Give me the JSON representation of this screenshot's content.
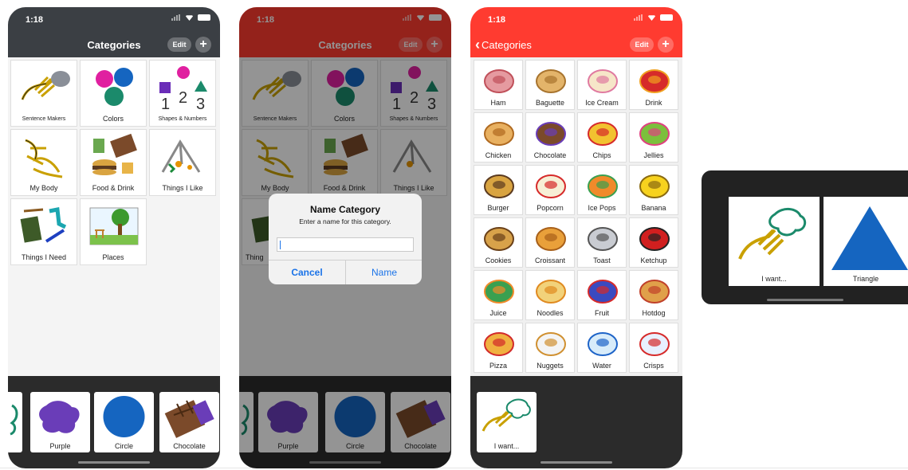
{
  "status": {
    "time": "1:18"
  },
  "screen1": {
    "title": "Categories",
    "edit_label": "Edit",
    "add_label": "+",
    "categories": [
      {
        "label": "Sentence Makers",
        "icon": "hand-speech-icon"
      },
      {
        "label": "Colors",
        "icon": "color-splats-icon"
      },
      {
        "label": "Shapes & Numbers",
        "icon": "shapes-numbers-icon"
      },
      {
        "label": "My Body",
        "icon": "body-icon"
      },
      {
        "label": "Food & Drink",
        "icon": "food-drink-icon"
      },
      {
        "label": "Things I Like",
        "icon": "playground-icon"
      },
      {
        "label": "Things I Need",
        "icon": "supplies-icon"
      },
      {
        "label": "Places",
        "icon": "park-icon"
      }
    ],
    "strip": [
      {
        "label": "",
        "icon": "partial-card-icon"
      },
      {
        "label": "Purple",
        "icon": "purple-splat-icon"
      },
      {
        "label": "Circle",
        "icon": "blue-circle-icon"
      },
      {
        "label": "Chocolate",
        "icon": "chocolate-icon"
      }
    ]
  },
  "screen2": {
    "title": "Categories",
    "edit_label": "Edit",
    "add_label": "+",
    "categories": [
      {
        "label": "Sentence Makers"
      },
      {
        "label": "Colors"
      },
      {
        "label": "Shapes & Numbers"
      },
      {
        "label": "My Body"
      },
      {
        "label": "Food & Drink"
      },
      {
        "label": "Things I Like"
      },
      {
        "label": "Thing"
      }
    ],
    "dialog": {
      "title": "Name Category",
      "message": "Enter a name for this category.",
      "input_value": "",
      "cancel_label": "Cancel",
      "confirm_label": "Name"
    },
    "strip": [
      {
        "label": ""
      },
      {
        "label": "Purple"
      },
      {
        "label": "Circle"
      },
      {
        "label": "Chocolate"
      }
    ]
  },
  "screen3": {
    "back_label": "Categories",
    "edit_label": "Edit",
    "add_label": "+",
    "foods": [
      {
        "label": "Ham",
        "icon": "ham-icon"
      },
      {
        "label": "Baguette",
        "icon": "baguette-icon"
      },
      {
        "label": "Ice Cream",
        "icon": "ice-cream-icon"
      },
      {
        "label": "Drink",
        "icon": "drink-icon"
      },
      {
        "label": "Chicken",
        "icon": "chicken-icon"
      },
      {
        "label": "Chocolate",
        "icon": "chocolate-icon"
      },
      {
        "label": "Chips",
        "icon": "chips-icon"
      },
      {
        "label": "Jellies",
        "icon": "jellies-icon"
      },
      {
        "label": "Burger",
        "icon": "burger-icon"
      },
      {
        "label": "Popcorn",
        "icon": "popcorn-icon"
      },
      {
        "label": "Ice Pops",
        "icon": "ice-pops-icon"
      },
      {
        "label": "Banana",
        "icon": "banana-icon"
      },
      {
        "label": "Cookies",
        "icon": "cookies-icon"
      },
      {
        "label": "Croissant",
        "icon": "croissant-icon"
      },
      {
        "label": "Toast",
        "icon": "toaster-icon"
      },
      {
        "label": "Ketchup",
        "icon": "ketchup-icon"
      },
      {
        "label": "Juice",
        "icon": "juice-icon"
      },
      {
        "label": "Noodles",
        "icon": "noodles-icon"
      },
      {
        "label": "Fruit",
        "icon": "fruit-bowl-icon"
      },
      {
        "label": "Hotdog",
        "icon": "hotdog-icon"
      },
      {
        "label": "Pizza",
        "icon": "pizza-icon"
      },
      {
        "label": "Nuggets",
        "icon": "nuggets-icon"
      },
      {
        "label": "Water",
        "icon": "water-bottle-icon"
      },
      {
        "label": "Crisps",
        "icon": "crisps-icon"
      }
    ],
    "strip": [
      {
        "label": "I want...",
        "icon": "hand-speech-icon"
      }
    ]
  },
  "tablet": {
    "cards": [
      {
        "label": "I want...",
        "icon": "hand-speech-icon"
      },
      {
        "label": "Triangle",
        "icon": "blue-triangle-icon"
      }
    ]
  },
  "colors": {
    "nav_dark": "#3b3f44",
    "nav_red": "#ff3b30",
    "dialog_blue": "#1a73e8",
    "strip_bg": "#2b2b2b"
  }
}
